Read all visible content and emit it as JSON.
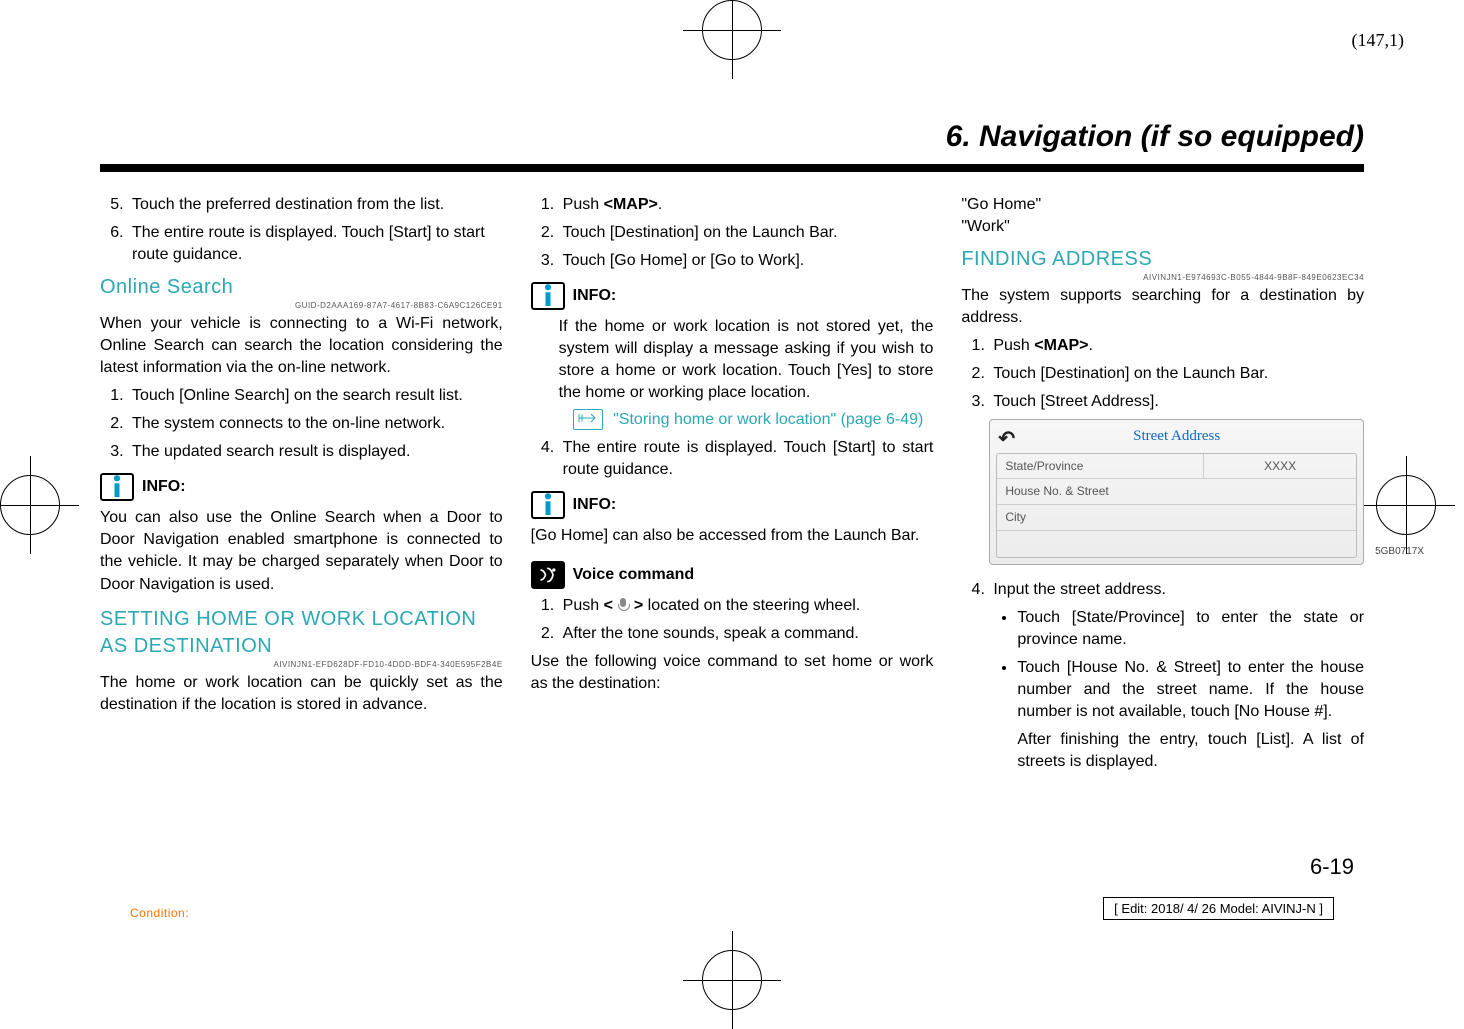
{
  "folio": "(147,1)",
  "heading": "6. Navigation (if so equipped)",
  "col1": {
    "steps_a": [
      "Touch the preferred destination from the list.",
      "The entire route is displayed. Touch [Start] to start route guidance."
    ],
    "online_search_title": "Online Search",
    "guid1": "GUID-D2AAA169-87A7-4617-8B83-C6A9C126CE91",
    "online_search_body": "When your vehicle is connecting to a Wi-Fi network, Online Search can search the location considering the latest information via the on-line network.",
    "steps_b": [
      "Touch [Online Search] on the search result list.",
      "The system connects to the on-line network.",
      "The updated search result is displayed."
    ],
    "info_label": "INFO:",
    "info_body": "You can also use the Online Search when a Door to Door Navigation enabled smartphone is connected to the vehicle. It may be charged separately when Door to Door Navigation is used.",
    "set_home_title": "SETTING HOME OR WORK LOCATION AS DESTINATION",
    "guid2": "AIVINJN1-EFD628DF-FD10-4DDD-BDF4-340E595F2B4E",
    "set_home_body": "The home or work location can be quickly set as the destination if the location is stored in advance."
  },
  "col2": {
    "steps_a": [
      "Push <MAP>.",
      "Touch [Destination] on the Launch Bar.",
      "Touch [Go Home] or [Go to Work]."
    ],
    "info_label": "INFO:",
    "info_body": "If the home or work location is not stored yet, the system will display a message asking if you wish to store a home or work location. Touch [Yes] to store the home or working place location.",
    "xref": "\"Storing home or work location\" (page 6-49)",
    "step4": "The entire route is displayed. Touch [Start] to start route guidance.",
    "info2_label": "INFO:",
    "info2_body": "[Go Home] can also be accessed from the Launch Bar.",
    "voice_label": "Voice command",
    "voice_steps": [
      "Push <    > located on the steering wheel.",
      "After the tone sounds, speak a command."
    ],
    "voice_tail": "Use the following voice command to set home or work as the destination:"
  },
  "col3": {
    "quotes": [
      "\"Go Home\"",
      "\"Work\""
    ],
    "find_title": "FINDING ADDRESS",
    "guid3": "AIVINJN1-E974693C-B055-4844-9B8F-849E0623EC34",
    "find_body": "The system supports searching for a destination by address.",
    "steps": [
      "Push <MAP>.",
      "Touch [Destination] on the Launch Bar.",
      "Touch [Street Address]."
    ],
    "shot": {
      "title": "Street Address",
      "row1a": "State/Province",
      "row1b": "XXXX",
      "row2": "House No. & Street",
      "row3": "City"
    },
    "shot_code": "5GB0717X",
    "step4": "Input the street address.",
    "bullets": [
      "Touch [State/Province] to enter the state or province name.",
      "Touch [House No. & Street] to enter the house number and the street name. If the house number is not available, touch [No House #]."
    ],
    "bullet_tail": "After finishing the entry, touch [List]. A list of streets is displayed."
  },
  "pgnum": "6-19",
  "condition": "Condition:",
  "editstamp": "[ Edit: 2018/ 4/ 26    Model:  AIVINJ-N ]"
}
